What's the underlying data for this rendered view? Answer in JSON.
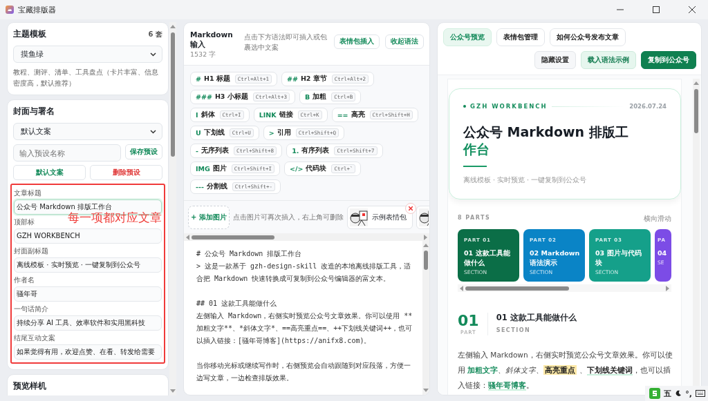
{
  "window": {
    "title": "宝藏排版器"
  },
  "theme_card": {
    "title": "主题模板",
    "count": "6 套",
    "selected_theme": "摸鱼绿",
    "description": "教程、测评、清单、工具盘点（卡片丰富、信息密度高，默认推荐）"
  },
  "cover_card": {
    "title": "封面与署名",
    "preset_select": "默认文案",
    "preset_name": {
      "placeholder": "输入预设名称"
    },
    "save_button": "保存预设",
    "buttons": [
      {
        "label": "默认文案",
        "kind": "primary"
      },
      {
        "label": "删除预设",
        "kind": "danger"
      }
    ],
    "annotation": "每一项都对应文章",
    "fields": [
      {
        "label": "文章标题",
        "value": "公众号 Markdown 排版工作台",
        "focused": true
      },
      {
        "label": "顶部标",
        "value": "GZH WORKBENCH",
        "focused": false
      },
      {
        "label": "封面副标题",
        "value": "离线模板 · 实时预览 · 一键复制到公众号",
        "focused": false
      },
      {
        "label": "作者名",
        "value": "骚年哥",
        "focused": false
      },
      {
        "label": "一句话简介",
        "value": "持续分享 AI 工具、效率软件和实用黑科技",
        "focused": false
      },
      {
        "label": "结尾互动文案",
        "value": "如果觉得有用，欢迎点赞、在看、转发给需要",
        "focused": false
      }
    ]
  },
  "device_card": {
    "title": "预览样机"
  },
  "editor": {
    "title": "Markdown 输入",
    "word_count": "1532 字",
    "hint": "点击下方语法即可插入或包裹选中文案",
    "buttons": [
      "表情包插入",
      "收起语法"
    ],
    "syntax": [
      {
        "mark": "#",
        "label": "H1 标题",
        "shortcut": "Ctrl+Alt+1"
      },
      {
        "mark": "##",
        "label": "H2 章节",
        "shortcut": "Ctrl+Alt+2"
      },
      {
        "mark": "###",
        "label": "H3 小标题",
        "shortcut": "Ctrl+Alt+3"
      },
      {
        "mark": "B",
        "label": "加粗",
        "shortcut": "Ctrl+B"
      },
      {
        "mark": "I",
        "label": "斜体",
        "shortcut": "Ctrl+I"
      },
      {
        "mark": "LINK",
        "label": "链接",
        "shortcut": "Ctrl+K"
      },
      {
        "mark": "==",
        "label": "高亮",
        "shortcut": "Ctrl+Shift+H"
      },
      {
        "mark": "U",
        "label": "下划线",
        "shortcut": "Ctrl+U"
      },
      {
        "mark": ">",
        "label": "引用",
        "shortcut": "Ctrl+Shift+Q"
      },
      {
        "mark": "-",
        "label": "无序列表",
        "shortcut": "Ctrl+Shift+8"
      },
      {
        "mark": "1.",
        "label": "有序列表",
        "shortcut": "Ctrl+Shift+7"
      },
      {
        "mark": "IMG",
        "label": "图片",
        "shortcut": "Ctrl+Shift+I"
      },
      {
        "mark": "</>",
        "label": "代码块",
        "shortcut": "Ctrl+`"
      },
      {
        "mark": "---",
        "label": "分割线",
        "shortcut": "Ctrl+Shift+-"
      }
    ],
    "add_image": "+ 添加图片",
    "image_hint": "点击图片可再次插入，右上角可删除",
    "images": [
      {
        "kind": "picture",
        "caption": "示例表情包",
        "deletable": true
      },
      {
        "kind": "picture"
      }
    ],
    "blocks": [
      [
        "# 公众号 Markdown 排版工作台",
        "> 这是一款基于 gzh-design-skill 改造的本地离线排版工具，适合把 Markdown 快速转换成可复制到公众号编辑器的富文本。"
      ],
      [
        "## 01 这款工具能做什么",
        "左侧输入 Markdown，右侧实时预览公众号文章效果。你可以使用 **加粗文字**、*斜体文字*、==高亮重点==、++下划线关键词++，也可以插入链接：[骚年哥博客](https://anifx8.com)。"
      ],
      [
        "当你移动光标或继续写作时，右侧预览会自动跟随到对应段落，方便一边写文章，一边检查排版效果。"
      ]
    ]
  },
  "preview": {
    "tabs": [
      {
        "label": "公众号预览",
        "selected": true
      },
      {
        "label": "表情包管理",
        "selected": false
      },
      {
        "label": "如何公众号发布文章",
        "selected": false
      }
    ],
    "actions": [
      {
        "label": "隐藏设置",
        "kind": "plain"
      },
      {
        "label": "载入语法示例",
        "kind": "soft"
      },
      {
        "label": "复制到公众号",
        "kind": "primary"
      }
    ],
    "cover": {
      "tag": "GZH WORKBENCH",
      "date": "2026.07.24",
      "title": "公众号 Markdown 排版工",
      "title_accent": "作台",
      "subtitle": "离线模板 · 实时预览 · 一键复制到公众号"
    },
    "parts_label": "8 PARTS",
    "parts_hint": "横向滑动",
    "parts": [
      {
        "part": "PART 01",
        "title": "01 这款工具能做什么",
        "sub": "SECTION",
        "color": "#0b6e47"
      },
      {
        "part": "PART 02",
        "title": "02 Markdown 语法演示",
        "sub": "SECTION",
        "color": "#0a84c6"
      },
      {
        "part": "PART 03",
        "title": "03 图片与代码块",
        "sub": "SECTION",
        "color": "#15a08a"
      },
      {
        "part": "PA",
        "title": "04",
        "sub": "SE",
        "color": "#7c4ce6"
      }
    ],
    "section": {
      "number": "01",
      "number_label": "PART",
      "title": "01 这款工具能做什么",
      "sub": "SECTION"
    },
    "paragraph": [
      {
        "kind": "plain",
        "text": "左侧输入 Markdown，右侧实时预览公众号文章效果。你可以使用 "
      },
      {
        "kind": "bold",
        "text": "加粗文字"
      },
      {
        "kind": "plain",
        "text": "、"
      },
      {
        "kind": "italic",
        "text": "斜体文字"
      },
      {
        "kind": "plain",
        "text": "、"
      },
      {
        "kind": "highlight",
        "text": "高亮重点"
      },
      {
        "kind": "plain",
        "text": " 、"
      },
      {
        "kind": "underline",
        "text": "下划线关键词"
      },
      {
        "kind": "plain",
        "text": "，也可以插入链接："
      },
      {
        "kind": "link",
        "text": "骚年哥博客"
      },
      {
        "kind": "plain",
        "text": "。"
      }
    ]
  },
  "ime": {
    "mode": "五",
    "punctuation": "°,"
  }
}
